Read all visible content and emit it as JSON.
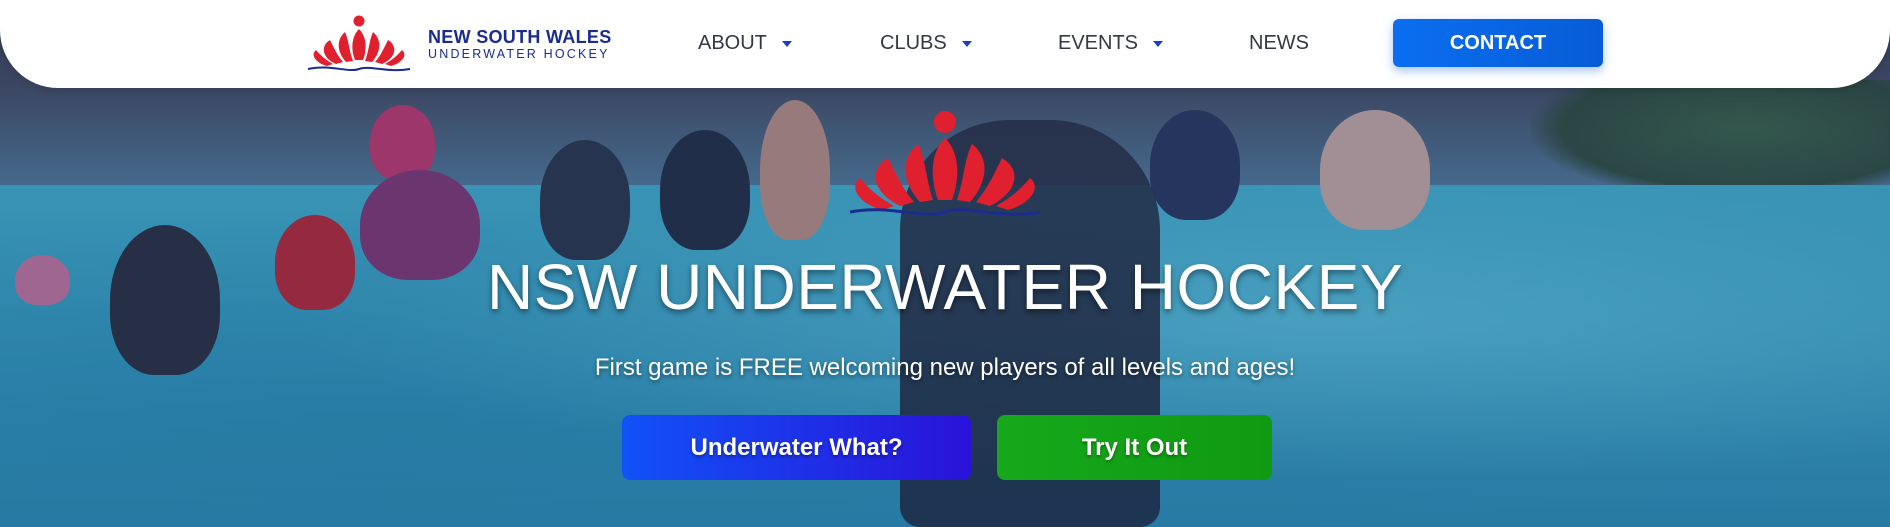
{
  "header": {
    "logo": {
      "line1": "NEW SOUTH WALES",
      "line2": "UNDERWATER HOCKEY",
      "icon": "fan-shell-logo-icon"
    },
    "nav": [
      {
        "label": "ABOUT",
        "has_dropdown": true
      },
      {
        "label": "CLUBS",
        "has_dropdown": true
      },
      {
        "label": "EVENTS",
        "has_dropdown": true
      },
      {
        "label": "NEWS",
        "has_dropdown": false
      }
    ],
    "contact_label": "CONTACT"
  },
  "hero": {
    "title": "NSW UNDERWATER HOCKEY",
    "subtitle": "First game is FREE welcoming new players of all levels and ages!",
    "buttons": {
      "primary_label": "Underwater What?",
      "secondary_label": "Try It Out"
    },
    "background_image": "pool-players-photo"
  },
  "colors": {
    "brand_blue": "#1a2c8f",
    "contact_blue": "#0a6ef0",
    "logo_red": "#e0202f",
    "cta_blue": "#1152f7",
    "cta_green": "#16a81b"
  }
}
